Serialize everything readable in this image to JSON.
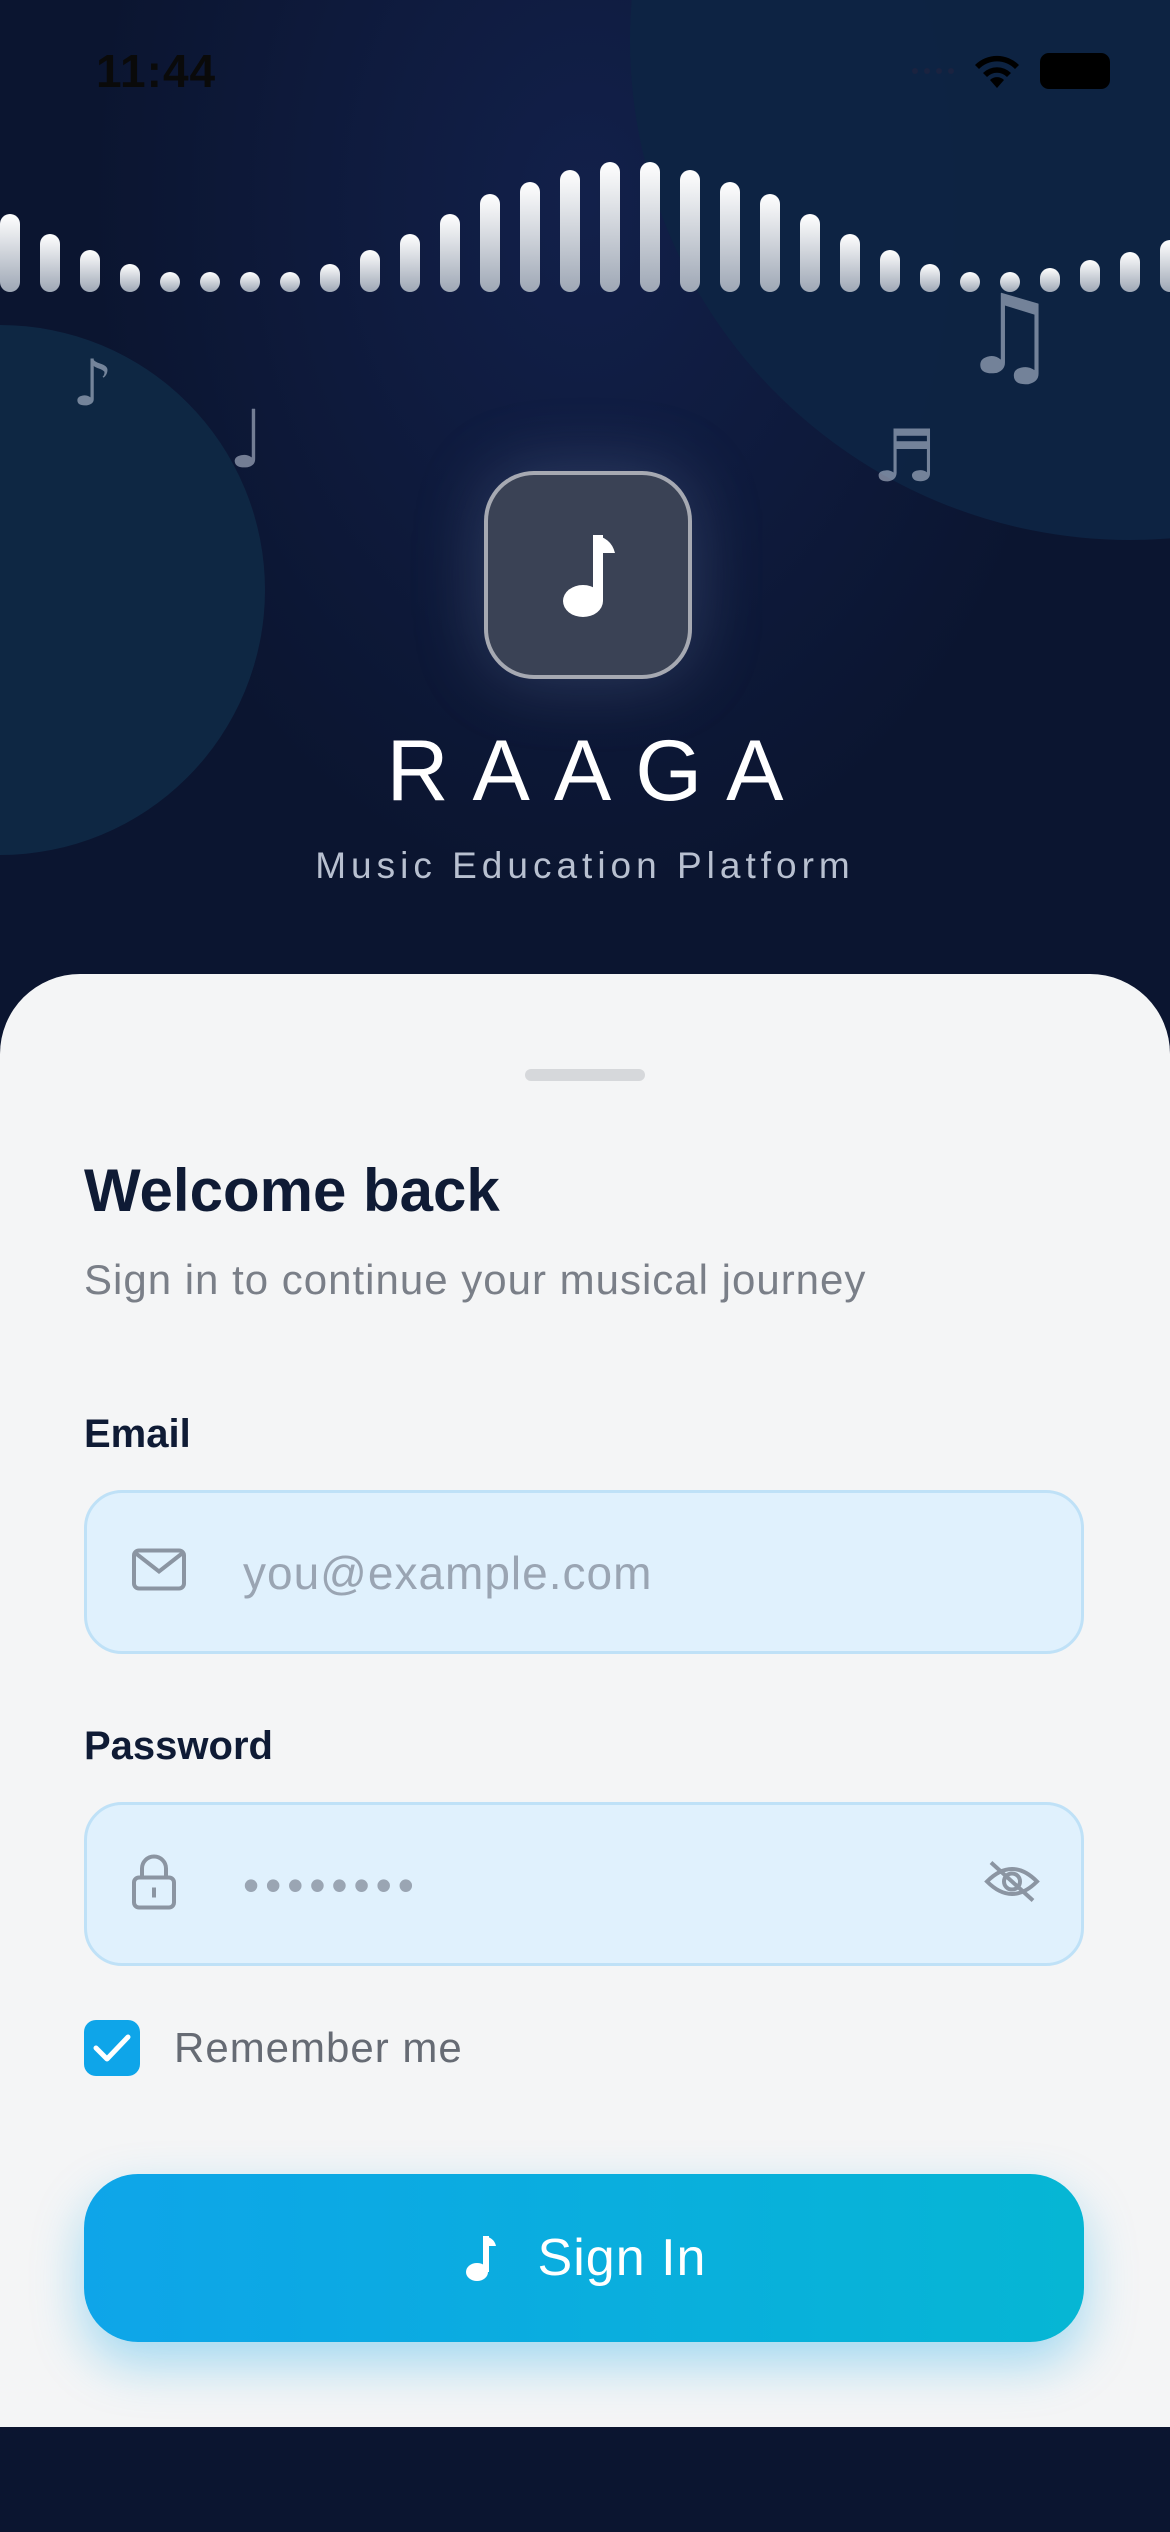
{
  "status_bar": {
    "time": "11:44"
  },
  "brand": {
    "name": "RAAGA",
    "tagline": "Music Education Platform",
    "notes": [
      "♪",
      "♩",
      "♫",
      "♬"
    ]
  },
  "login": {
    "title": "Welcome back",
    "subtitle": "Sign in to continue your musical journey",
    "email_label": "Email",
    "email_placeholder": "you@example.com",
    "password_label": "Password",
    "password_placeholder": "••••••••",
    "remember_label": "Remember me",
    "remember_checked": true,
    "submit_label": "Sign In"
  },
  "colors": {
    "background": "#0b1530",
    "accent": "#0ea5e9",
    "accent_end": "#06b6d4",
    "field_bg": "#e0f1fd",
    "card_bg": "#f4f5f6"
  },
  "icons": {
    "logo": "music-note-icon",
    "email": "mail-icon",
    "password": "lock-icon",
    "toggle": "eye-off-icon",
    "checkbox": "check-icon",
    "submit": "music-note-icon"
  }
}
